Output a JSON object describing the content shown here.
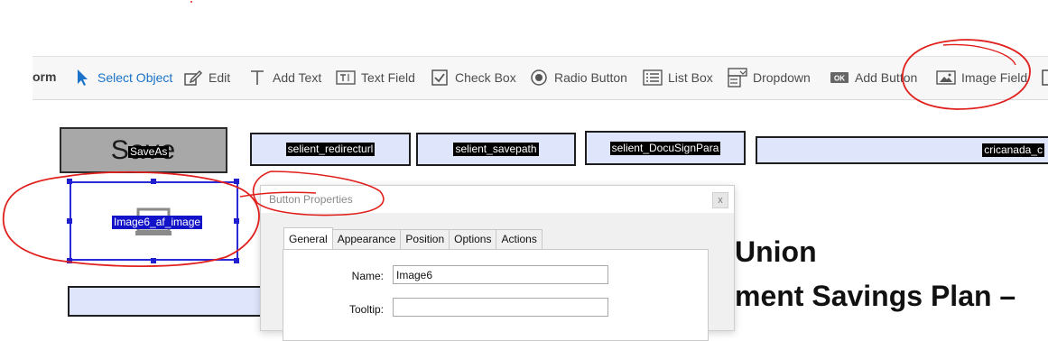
{
  "toolbar": {
    "form_label": "orm",
    "items": [
      {
        "label": "Select Object",
        "icon": "cursor-arrow-icon",
        "active": true
      },
      {
        "label": "Edit",
        "icon": "edit-icon"
      },
      {
        "label": "Add Text",
        "icon": "text-t-icon"
      },
      {
        "label": "Text Field",
        "icon": "text-field-icon"
      },
      {
        "label": "Check Box",
        "icon": "checkbox-icon"
      },
      {
        "label": "Radio Button",
        "icon": "radio-button-icon"
      },
      {
        "label": "List Box",
        "icon": "list-box-icon"
      },
      {
        "label": "Dropdown",
        "icon": "dropdown-icon"
      },
      {
        "label": "Add Button",
        "icon": "ok-button-icon"
      },
      {
        "label": "Image Field",
        "icon": "image-icon"
      }
    ]
  },
  "form": {
    "save_button_big": "Save",
    "save_button_small": "SaveAs",
    "fields": [
      {
        "label": "selient_redirecturl"
      },
      {
        "label": "selient_savepath"
      },
      {
        "label": "selient_DocuSignPara"
      },
      {
        "label": "cricanada_c"
      }
    ],
    "image_field_label": "Image6_af_image"
  },
  "dialog": {
    "title": "Button Properties",
    "close_glyph": "x",
    "tabs": [
      "General",
      "Appearance",
      "Position",
      "Options",
      "Actions"
    ],
    "active_tab": "General",
    "name_label": "Name:",
    "name_value": "Image6",
    "tooltip_label": "Tooltip:",
    "tooltip_value": ""
  },
  "background_text": {
    "line1": "Union",
    "line2": "ment Savings Plan –"
  },
  "colors": {
    "accent_blue": "#1a73c8",
    "annotation_red": "#e0201c",
    "field_fill": "#dfe5fb",
    "selection_blue": "#1212c9"
  }
}
